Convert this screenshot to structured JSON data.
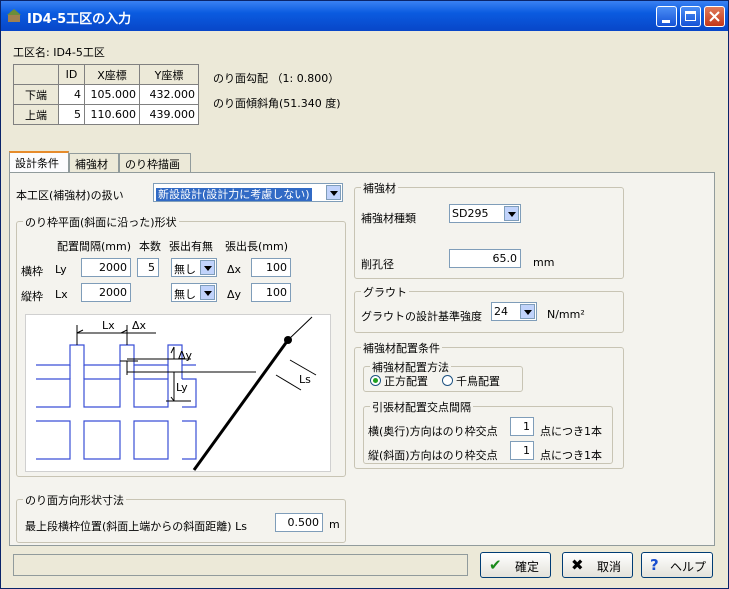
{
  "window": {
    "title": "ID4-5工区の入力"
  },
  "header": {
    "zone_label": "工区名: ID4-5工区",
    "slope_grade": "のり面勾配 （1: 0.800）",
    "slope_angle": "のり面傾斜角(51.340 度)",
    "table": {
      "columns": [
        "",
        "ID",
        "X座標",
        "Y座標"
      ],
      "rows": [
        {
          "name": "下端",
          "id": "4",
          "x": "105.000",
          "y": "432.000"
        },
        {
          "name": "上端",
          "id": "5",
          "x": "110.600",
          "y": "439.000"
        }
      ]
    }
  },
  "tabs": [
    {
      "label": "設計条件",
      "active": true
    },
    {
      "label": "補強材",
      "active": false
    },
    {
      "label": "のり枠描画",
      "active": false
    }
  ],
  "design": {
    "treatment_label": "本工区(補強材)の扱い",
    "treatment_value": "新設設計(設計力に考慮しない)",
    "frame_group": "のり枠平面(斜面に沿った)形状",
    "col_spacing": "配置間隔(mm)",
    "col_count": "本数",
    "col_overhang": "張出有無",
    "col_overhang_len": "張出長(mm)",
    "row_h": {
      "label": "横枠",
      "sym": "Ly",
      "spacing": "2000",
      "count": "5",
      "overhang": "無し",
      "dsym": "Δx",
      "len": "100"
    },
    "row_v": {
      "label": "縦枠",
      "sym": "Lx",
      "spacing": "2000",
      "overhang": "無し",
      "dsym": "Δy",
      "len": "100"
    },
    "diagram": {
      "lx": "Lx",
      "dx": "Δx",
      "dy": "Δy",
      "ly": "Ly",
      "ls": "Ls"
    },
    "normal_group": "のり面方向形状寸法",
    "top_pos_label": "最上段横枠位置(斜面上端からの斜面距離) Ls",
    "top_pos_value": "0.500",
    "top_pos_unit": "m"
  },
  "reinforce": {
    "group": "補強材",
    "type_label": "補強材種類",
    "type_value": "SD295",
    "hole_label": "削孔径",
    "hole_value": "65.0",
    "hole_unit": "mm"
  },
  "grout": {
    "group": "グラウト",
    "strength_label": "グラウトの設計基準強度",
    "strength_value": "24",
    "strength_unit": "N/mm²"
  },
  "layout": {
    "group": "補強材配置条件",
    "method_group": "補強材配置方法",
    "opt_square": "正方配置",
    "opt_stagger": "千鳥配置",
    "cross_group": "引張材配置交点間隔",
    "horiz_label": "横(奥行)方向はのり枠交点",
    "horiz_value": "1",
    "horiz_unit": "点につき1本",
    "vert_label": "縦(斜面)方向はのり枠交点",
    "vert_value": "1",
    "vert_unit": "点につき1本"
  },
  "buttons": {
    "ok": "確定",
    "cancel": "取消",
    "help": "ヘルプ"
  },
  "colors": {
    "title_bar": "#0a5be0",
    "grid_lines": "#3a4fd6",
    "selection": "#316ac5"
  }
}
